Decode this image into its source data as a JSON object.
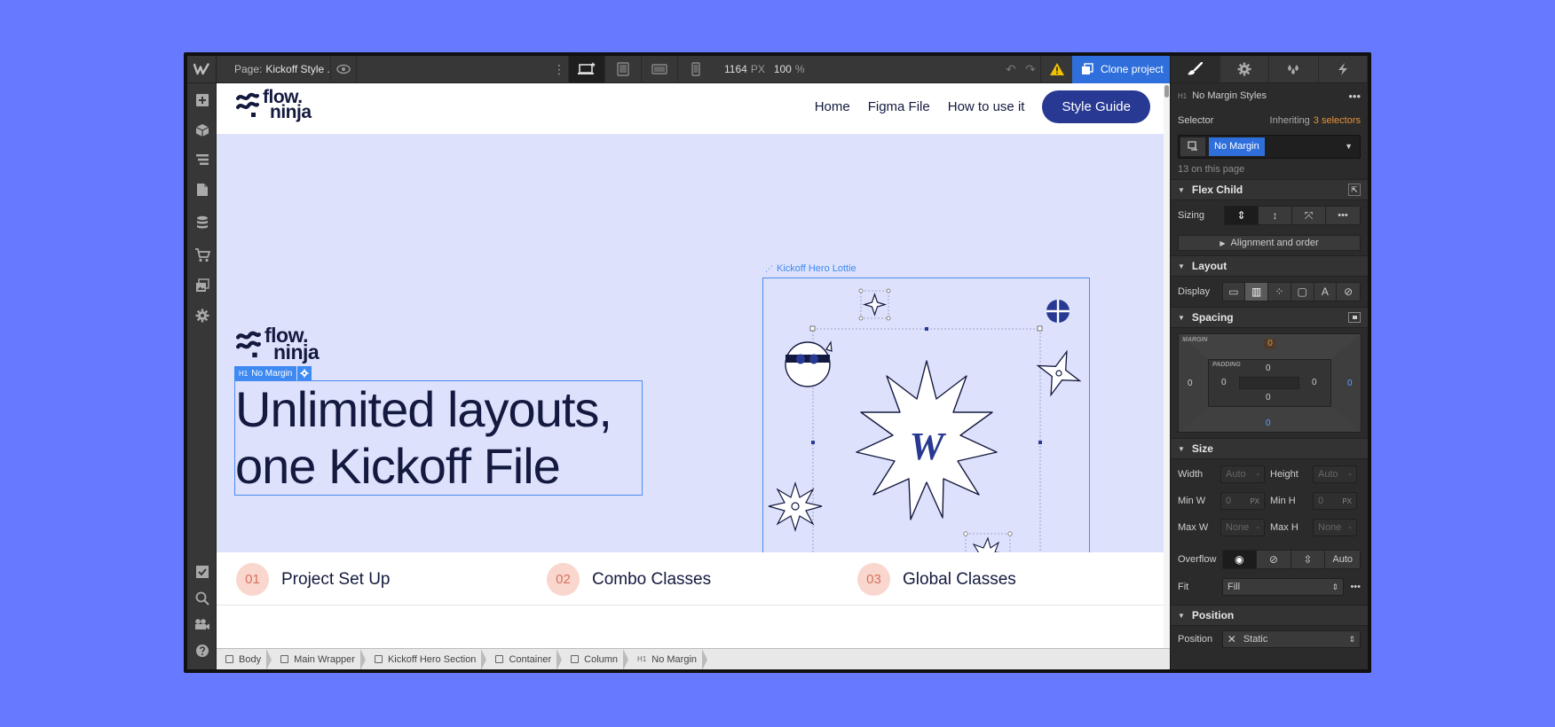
{
  "topbar": {
    "page_label": "Page:",
    "page_name": "Kickoff Style ...",
    "width_value": "1164",
    "width_unit": "PX",
    "zoom_value": "100",
    "zoom_unit": "%",
    "clone_label": "Clone project"
  },
  "site": {
    "nav": [
      "Home",
      "Figma File",
      "How to use it"
    ],
    "cta": "Style Guide",
    "logo_line1": "flow.",
    "logo_line2": "ninja",
    "hero_title_line1": "Unlimited layouts,",
    "hero_title_line2": "one Kickoff File",
    "selected_tag": "No Margin",
    "lottie_label": "Kickoff Hero Lottie",
    "steps": [
      {
        "num": "01",
        "label": "Project Set Up"
      },
      {
        "num": "02",
        "label": "Combo Classes"
      },
      {
        "num": "03",
        "label": "Global Classes"
      }
    ]
  },
  "breadcrumbs": [
    "Body",
    "Main Wrapper",
    "Kickoff Hero Section",
    "Container",
    "Column",
    "No Margin"
  ],
  "panel": {
    "element_title": "No Margin Styles",
    "selector_label": "Selector",
    "inheriting_label": "Inheriting",
    "inheriting_count": "3 selectors",
    "selector_chip": "No Margin",
    "on_page": "13 on this page",
    "flex_child": "Flex Child",
    "sizing_label": "Sizing",
    "align_order": "Alignment and order",
    "layout": "Layout",
    "display_label": "Display",
    "spacing": "Spacing",
    "margin_label": "MARGIN",
    "padding_label": "PADDING",
    "margin": {
      "top": "0",
      "right": "0",
      "bottom": "0",
      "left": "0"
    },
    "padding": {
      "top": "0",
      "right": "0",
      "bottom": "0",
      "left": "0"
    },
    "size": "Size",
    "width_label": "Width",
    "height_label": "Height",
    "minw_label": "Min W",
    "minh_label": "Min H",
    "maxw_label": "Max W",
    "maxh_label": "Max H",
    "auto": "Auto",
    "zero": "0",
    "px": "PX",
    "none": "None",
    "overflow_label": "Overflow",
    "overflow_auto": "Auto",
    "fit_label": "Fit",
    "fit_value": "Fill",
    "position_section": "Position",
    "position_label": "Position",
    "position_value": "Static"
  },
  "colors": {
    "background": "#6679ff",
    "accent": "#2f6fdc",
    "hero_bg": "#dde1fc",
    "navy": "#141a3f",
    "warning": "#f2c200",
    "inherit_orange": "#e8913a"
  }
}
